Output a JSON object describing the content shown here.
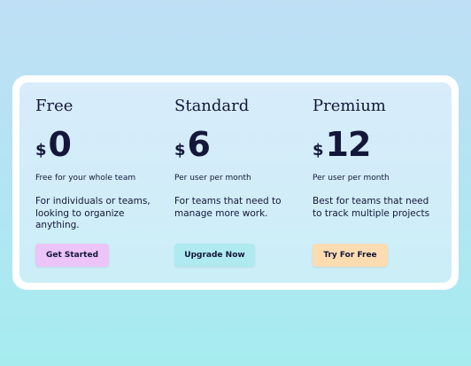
{
  "plans": [
    {
      "name": "Free",
      "currency": "$",
      "amount": "0",
      "period": "Free for your whole team",
      "description": "For individuals or teams, looking to organize anything.",
      "button": "Get Started",
      "button_color": "#ecc4f7"
    },
    {
      "name": "Standard",
      "currency": "$",
      "amount": "6",
      "period": "Per user per month",
      "description": "For teams that need to manage more work.",
      "button": "Upgrade Now",
      "button_color": "#aeeaf0"
    },
    {
      "name": "Premium",
      "currency": "$",
      "amount": "12",
      "period": "Per user per month",
      "description": "Best for teams that need to track multiple projects",
      "button": "Try For Free",
      "button_color": "#fddcb2"
    }
  ],
  "colors": {
    "text": "#14173a",
    "card": "#ffffff"
  }
}
